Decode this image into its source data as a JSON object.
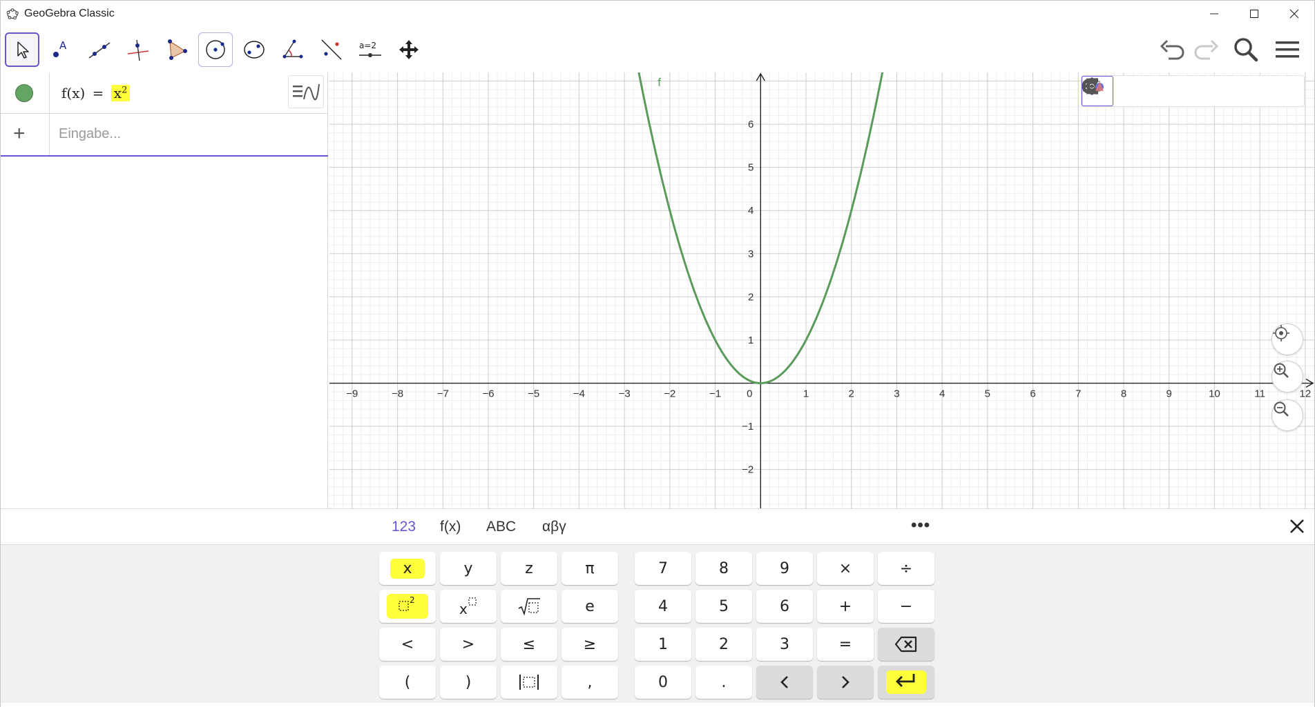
{
  "window": {
    "title": "GeoGebra Classic"
  },
  "algebra": {
    "items": [
      {
        "label": "f(x)",
        "equals": "=",
        "base": "x",
        "exp": "2"
      }
    ],
    "input_placeholder": "Eingabe..."
  },
  "graph": {
    "function_label": "f",
    "function_color": "#5a9a5a",
    "x_ticks": [
      "−9",
      "−8",
      "−7",
      "−6",
      "−5",
      "−4",
      "−3",
      "−2",
      "−1",
      "0",
      "1",
      "2",
      "3",
      "4",
      "5",
      "6",
      "7",
      "8",
      "9",
      "10",
      "11",
      "12"
    ],
    "y_ticks": [
      "6",
      "5",
      "4",
      "3",
      "2",
      "1",
      "−1",
      "−2"
    ],
    "x_range": [
      -9.5,
      12.2
    ],
    "y_range": [
      -2.9,
      7.2
    ]
  },
  "keyboard": {
    "tabs": [
      "123",
      "f(x)",
      "ABC",
      "αβγ"
    ],
    "active_tab": "123",
    "more": "•••",
    "left_keys": [
      [
        "x",
        "y",
        "z",
        "π"
      ],
      [
        "x²",
        "xⁿ",
        "√",
        "e"
      ],
      [
        "<",
        ">",
        "≤",
        "≥"
      ],
      [
        "(",
        ")",
        "|x|",
        ","
      ]
    ],
    "right_keys": [
      [
        "7",
        "8",
        "9",
        "×",
        "÷"
      ],
      [
        "4",
        "5",
        "6",
        "+",
        "−"
      ],
      [
        "1",
        "2",
        "3",
        "=",
        "⌫"
      ],
      [
        "0",
        ".",
        "<",
        ">",
        "↵"
      ]
    ]
  },
  "colors": {
    "accent": "#6557d2",
    "highlight": "#ffff3b",
    "grid_minor": "#eeeeee",
    "grid_major": "#cfcfcf"
  }
}
